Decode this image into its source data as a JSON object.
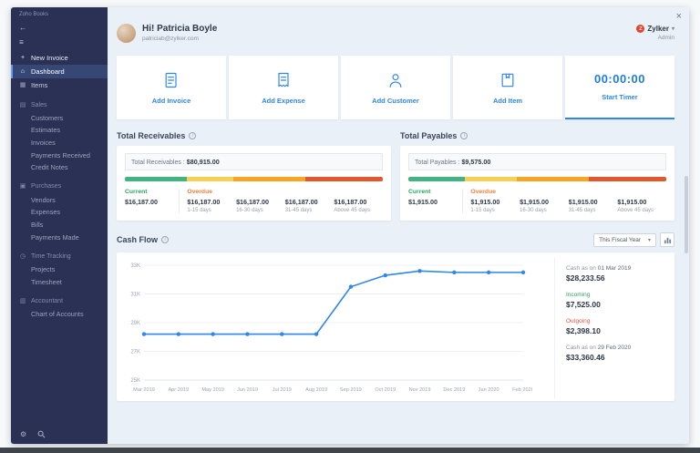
{
  "sidebar": {
    "brand": "Zoho Books",
    "back_glyph": "←",
    "menu_glyph": "≡",
    "gear_glyph": "⚙",
    "nav": [
      {
        "label": "New Invoice",
        "icon": "plus-icon",
        "glyph": "+",
        "type": "item newinvoice"
      },
      {
        "label": "Dashboard",
        "icon": "home-icon",
        "glyph": "⌂",
        "type": "item active"
      },
      {
        "label": "Items",
        "icon": "items-icon",
        "glyph": "▦",
        "type": "item"
      },
      {
        "label": "Sales",
        "icon": "sales-icon",
        "glyph": "▤",
        "type": "section"
      },
      {
        "label": "Customers",
        "type": "subitem"
      },
      {
        "label": "Estimates",
        "type": "subitem"
      },
      {
        "label": "Invoices",
        "type": "subitem"
      },
      {
        "label": "Payments Received",
        "type": "subitem"
      },
      {
        "label": "Credit Notes",
        "type": "subitem"
      },
      {
        "label": "Purchases",
        "icon": "purchases-icon",
        "glyph": "▣",
        "type": "section"
      },
      {
        "label": "Vendors",
        "type": "subitem"
      },
      {
        "label": "Expenses",
        "type": "subitem"
      },
      {
        "label": "Bills",
        "type": "subitem"
      },
      {
        "label": "Payments Made",
        "type": "subitem"
      },
      {
        "label": "Time Tracking",
        "icon": "clock-icon",
        "glyph": "◷",
        "type": "section"
      },
      {
        "label": "Projects",
        "type": "subitem"
      },
      {
        "label": "Timesheet",
        "type": "subitem"
      },
      {
        "label": "Accountant",
        "icon": "accountant-icon",
        "glyph": "▥",
        "type": "section"
      },
      {
        "label": "Chart of Accounts",
        "type": "subitem"
      }
    ]
  },
  "header": {
    "greeting": "Hi! Patricia Boyle",
    "email": "patriciab@zylker.com",
    "org_initial": "Z",
    "org_name": "Zylker",
    "org_caret": "▾",
    "role": "Admin",
    "close_glyph": "×"
  },
  "quick_actions": {
    "items": [
      {
        "label": "Add Invoice"
      },
      {
        "label": "Add Expense"
      },
      {
        "label": "Add Customer"
      },
      {
        "label": "Add Item"
      },
      {
        "label": "Start Timer",
        "time": "00:00:00"
      }
    ]
  },
  "receivables": {
    "title": "Total Receivables",
    "summary_label": "Total Receivables :",
    "summary_value": "$80,915.00",
    "current_label": "Current",
    "current_value": "$16,187.00",
    "overdue_label": "Overdue",
    "buckets": [
      {
        "value": "$16,187.00",
        "range": "1-15 days"
      },
      {
        "value": "$16,187.00",
        "range": "16-30 days"
      },
      {
        "value": "$16,187.00",
        "range": "31-45 days"
      },
      {
        "value": "$16,187.00",
        "range": "Above 45 days"
      }
    ],
    "bar_segments": [
      {
        "color": "#43b384",
        "pct": 24
      },
      {
        "color": "#f6d155",
        "pct": 18
      },
      {
        "color": "#f5a623",
        "pct": 28
      },
      {
        "color": "#e1582e",
        "pct": 30
      }
    ]
  },
  "payables": {
    "title": "Total Payables",
    "summary_label": "Total Payables :",
    "summary_value": "$9,575.00",
    "current_label": "Current",
    "current_value": "$1,915.00",
    "overdue_label": "Overdue",
    "buckets": [
      {
        "value": "$1,915.00",
        "range": "1-15 days"
      },
      {
        "value": "$1,915.00",
        "range": "16-30 days"
      },
      {
        "value": "$1,915.00",
        "range": "31-45 days"
      },
      {
        "value": "$1,915.00",
        "range": "Above 45 days"
      }
    ],
    "bar_segments": [
      {
        "color": "#43b384",
        "pct": 22
      },
      {
        "color": "#f6d155",
        "pct": 20
      },
      {
        "color": "#f5a623",
        "pct": 28
      },
      {
        "color": "#e1582e",
        "pct": 30
      }
    ]
  },
  "cashflow": {
    "title": "Cash Flow",
    "period_selector": "This Fiscal Year",
    "period_caret": "▾",
    "stats": [
      {
        "label": "Cash as on",
        "date": "01 Mar 2019",
        "value": "$28,233.56",
        "type": "cash"
      },
      {
        "label": "Incoming",
        "date": "",
        "value": "$7,525.00",
        "type": "incoming"
      },
      {
        "label": "Outgoing",
        "date": "",
        "value": "$2,398.10",
        "type": "outgoing"
      },
      {
        "label": "Cash as on",
        "date": "29 Feb 2020",
        "value": "$33,360.46",
        "type": "cash"
      }
    ]
  },
  "chart_data": {
    "type": "line",
    "title": "Cash Flow",
    "x": [
      "Mar 2019",
      "Apr 2019",
      "May 2019",
      "Jun 2019",
      "Jul 2019",
      "Aug 2019",
      "Sep 2019",
      "Oct 2019",
      "Nov 2019",
      "Dec 2019",
      "Jan 2020",
      "Feb 2020"
    ],
    "series": [
      {
        "name": "Cash",
        "values": [
          28.2,
          28.2,
          28.2,
          28.2,
          28.2,
          28.2,
          31.5,
          32.3,
          32.6,
          32.5,
          32.5,
          32.5
        ]
      }
    ],
    "units": "thousands USD",
    "ylim": [
      25,
      33
    ],
    "yticks": [
      25,
      27,
      29,
      31,
      33
    ],
    "ytick_labels": [
      "25K",
      "27K",
      "29K",
      "31K",
      "33K"
    ],
    "grid": true,
    "legend": "none",
    "line_color": "#2f87e8"
  }
}
